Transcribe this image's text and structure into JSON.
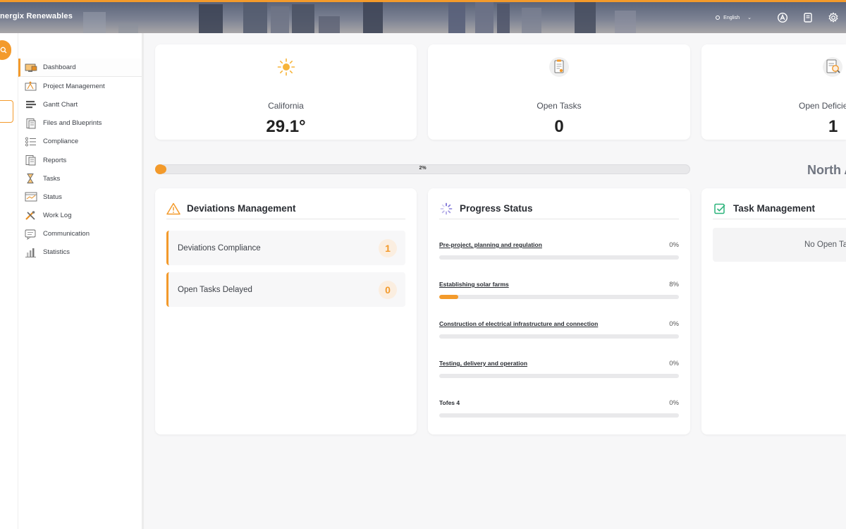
{
  "header": {
    "brand": "nergix Renewables",
    "language": "English",
    "icons": [
      "globe-icon",
      "chevron-down-icon",
      "app-icon",
      "book-icon",
      "gear-icon"
    ]
  },
  "sidebar": {
    "items": [
      {
        "label": "Dashboard",
        "icon": "dashboard-icon",
        "active": true
      },
      {
        "label": "Project Management",
        "icon": "project-icon"
      },
      {
        "label": "Gantt Chart",
        "icon": "gantt-icon"
      },
      {
        "label": "Files and Blueprints",
        "icon": "files-icon"
      },
      {
        "label": "Compliance",
        "icon": "compliance-icon"
      },
      {
        "label": "Reports",
        "icon": "reports-icon"
      },
      {
        "label": "Tasks",
        "icon": "tasks-icon"
      },
      {
        "label": "Status",
        "icon": "status-icon"
      },
      {
        "label": "Work Log",
        "icon": "worklog-icon"
      },
      {
        "label": "Communication",
        "icon": "communication-icon"
      },
      {
        "label": "Statistics",
        "icon": "statistics-icon"
      }
    ]
  },
  "stats": [
    {
      "label": "California",
      "value": "29.1°",
      "icon": "sun-icon"
    },
    {
      "label": "Open Tasks",
      "value": "0",
      "icon": "clipboard-icon"
    },
    {
      "label": "Open Deficie",
      "value": "1",
      "icon": "magnifier-doc-icon"
    }
  ],
  "overall_progress": {
    "text": "2%",
    "fraction": 0.02
  },
  "region_label": "North A",
  "deviations": {
    "title": "Deviations Management",
    "rows": [
      {
        "label": "Deviations Compliance",
        "count": "1"
      },
      {
        "label": "Open Tasks Delayed",
        "count": "0"
      }
    ]
  },
  "progress_status": {
    "title": "Progress Status",
    "rows": [
      {
        "name": "Pre-project, planning and regulation",
        "pct": "0%",
        "fraction": 0,
        "underline": true
      },
      {
        "name": "Establishing solar farms",
        "pct": "8%",
        "fraction": 0.08,
        "underline": true
      },
      {
        "name": "Construction of electrical infrastructure and connection",
        "pct": "0%",
        "fraction": 0,
        "underline": true
      },
      {
        "name": "Testing, delivery and operation",
        "pct": "0%",
        "fraction": 0,
        "underline": true
      },
      {
        "name": "Tofes 4",
        "pct": "0%",
        "fraction": 0,
        "underline": false
      }
    ]
  },
  "task_management": {
    "title": "Task Management",
    "empty_text": "No Open Ta"
  },
  "colors": {
    "accent": "#f39a2b",
    "accent_soft": "#fbeee0"
  }
}
